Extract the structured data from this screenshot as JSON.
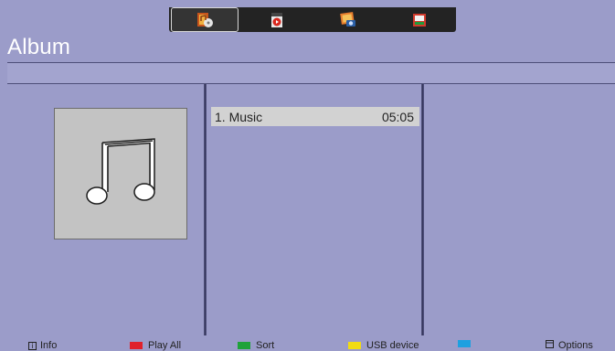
{
  "tabs": [
    {
      "icon": "music-icon",
      "active": true
    },
    {
      "icon": "video-icon",
      "active": false
    },
    {
      "icon": "photo-icon",
      "active": false
    },
    {
      "icon": "files-icon",
      "active": false
    }
  ],
  "page_title": "Album",
  "album_art_icon": "music-note-icon",
  "tracks": [
    {
      "title": "1. Music",
      "duration": "05:05",
      "selected": true
    }
  ],
  "footer": {
    "info": {
      "label": "Info",
      "key_glyph": "i"
    },
    "play_all": {
      "label": "Play All",
      "color": "#e0212b"
    },
    "sort": {
      "label": "Sort",
      "color": "#1fa23a"
    },
    "usb_device": {
      "label": "USB device",
      "color": "#f2dc12"
    },
    "blue_key": {
      "label": "",
      "color": "#1ea0e0"
    },
    "options": {
      "label": "Options"
    }
  },
  "colors": {
    "background": "#9b9cc9",
    "selection": "#d2d2d2"
  }
}
